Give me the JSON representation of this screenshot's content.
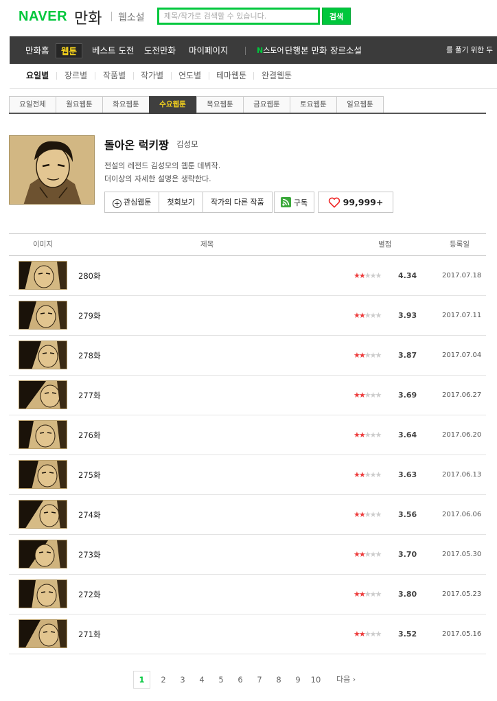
{
  "header": {
    "logo_naver": "NAVER",
    "logo_manhwa": "만화",
    "logo_novel": "웹소설",
    "search_placeholder": "제목/작가로 검색할 수 있습니다.",
    "search_button": "검색"
  },
  "gnb": {
    "items": [
      "만화홈",
      "웹툰",
      "베스트 도전",
      "도전만화",
      "마이페이지"
    ],
    "active_index": 1,
    "nstore_n": "N",
    "nstore_label": "스토어",
    "store_items": [
      "단행본 만화",
      "장르소설"
    ],
    "right_text": "를 풀기 위한 두"
  },
  "lnb": {
    "items": [
      "요일별",
      "장르별",
      "작품별",
      "작가별",
      "연도별",
      "테마웹툰",
      "완결웹툰"
    ]
  },
  "day_tabs": [
    "요일전체",
    "월요웹툰",
    "화요웹툰",
    "수요웹툰",
    "목요웹툰",
    "금요웹툰",
    "토요웹툰",
    "일요웹툰"
  ],
  "comic": {
    "title": "돌아온 럭키짱",
    "author": "김성모",
    "desc_line1": "전설의 레전드 김성모의 웹툰 데뷔작.",
    "desc_line2": "더이상의 자세한 설명은 생략한다.",
    "btn_favorite": "관심웹툰",
    "btn_first": "첫회보기",
    "btn_other": "작가의 다른 작품",
    "btn_rss": "구독",
    "like_count": "99,999+"
  },
  "table": {
    "col_image": "이미지",
    "col_title": "제목",
    "col_rating": "별점",
    "col_date": "등록일",
    "episodes": [
      {
        "title": "280화",
        "score": "4.34",
        "date": "2017.07.18"
      },
      {
        "title": "279화",
        "score": "3.93",
        "date": "2017.07.11"
      },
      {
        "title": "278화",
        "score": "3.87",
        "date": "2017.07.04"
      },
      {
        "title": "277화",
        "score": "3.69",
        "date": "2017.06.27"
      },
      {
        "title": "276화",
        "score": "3.64",
        "date": "2017.06.20"
      },
      {
        "title": "275화",
        "score": "3.63",
        "date": "2017.06.13"
      },
      {
        "title": "274화",
        "score": "3.56",
        "date": "2017.06.06"
      },
      {
        "title": "273화",
        "score": "3.70",
        "date": "2017.05.30"
      },
      {
        "title": "272화",
        "score": "3.80",
        "date": "2017.05.23"
      },
      {
        "title": "271화",
        "score": "3.52",
        "date": "2017.05.16"
      }
    ]
  },
  "paging": {
    "pages": [
      "1",
      "2",
      "3",
      "4",
      "5",
      "6",
      "7",
      "8",
      "9",
      "10"
    ],
    "next": "다음"
  },
  "colors": {
    "brand_green": "#00c73c",
    "nav_dark": "#3b3b3b",
    "active_yellow": "#f5d21c",
    "star_red": "#ed3b3b"
  }
}
